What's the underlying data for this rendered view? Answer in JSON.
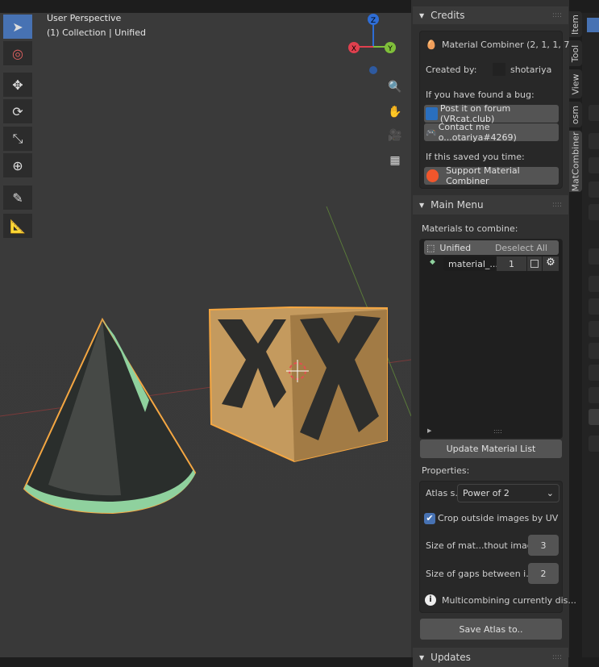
{
  "viewport": {
    "perspective": "User Perspective",
    "collection": "(1) Collection | Unified",
    "gizmo": {
      "z": "Z",
      "x": "X",
      "y": "Y"
    }
  },
  "toolbar": [
    "select-box",
    "cursor",
    "move",
    "rotate",
    "scale",
    "transform",
    "annotate",
    "measure"
  ],
  "credits": {
    "title": "Credits",
    "addon": "Material Combiner (2, 1, 1, 7)",
    "created_by": "Created by:",
    "author": "shotariya",
    "bug_label": "If you have found a bug:",
    "forum": "Post it on forum (VRcat.club)",
    "contact": "Contact me o...otariya#4269)",
    "saved_label": "If this saved you time:",
    "support": "Support Material Combiner"
  },
  "main_menu": {
    "title": "Main Menu",
    "materials_label": "Materials to combine:",
    "object": "Unified",
    "deselect": "Deselect All",
    "material": "material_...",
    "material_count": "1",
    "material_checked": false,
    "update": "Update Material List",
    "properties_label": "Properties:",
    "atlas_label": "Atlas s...",
    "atlas_value": "Power of 2",
    "crop_label": "Crop outside images by UV",
    "crop_checked": true,
    "size_mat_label": "Size of mat...thout image",
    "size_mat_value": "3",
    "gaps_label": "Size of gaps between i...",
    "gaps_value": "2",
    "info": "Multicombining currently dis...",
    "save": "Save Atlas to.."
  },
  "updates": {
    "title": "Updates"
  },
  "tabs": [
    "Item",
    "Tool",
    "View",
    "osm",
    "MatCombiner"
  ],
  "colors": {
    "accent": "#4772b3",
    "selection": "#f5a742",
    "cone_edge": "#8fd19e"
  }
}
